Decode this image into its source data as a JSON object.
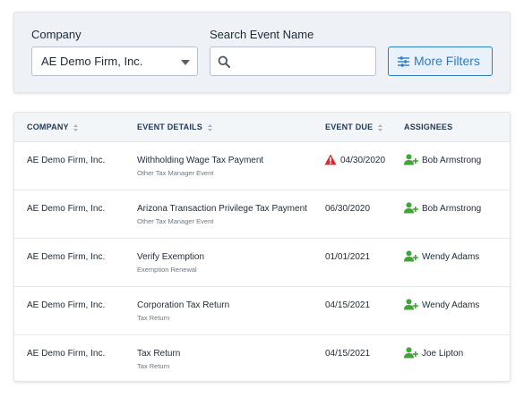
{
  "filters": {
    "company_label": "Company",
    "company_value": "AE Demo Firm, Inc.",
    "search_label": "Search Event Name",
    "search_value": "",
    "search_placeholder": "",
    "more_filters_label": "More Filters"
  },
  "table": {
    "headers": {
      "company": "COMPANY",
      "event_details": "EVENT DETAILS",
      "event_due": "EVENT DUE",
      "assignees": "ASSIGNEES"
    },
    "rows": [
      {
        "company": "AE Demo Firm, Inc.",
        "event": "Withholding Wage Tax Payment",
        "event_type": "Other Tax Manager Event",
        "due": "04/30/2020",
        "overdue": true,
        "assignee": "Bob Armstrong"
      },
      {
        "company": "AE Demo Firm, Inc.",
        "event": "Arizona Transaction Privilege Tax Payment",
        "event_type": "Other Tax Manager Event",
        "due": "06/30/2020",
        "overdue": false,
        "assignee": "Bob Armstrong"
      },
      {
        "company": "AE Demo Firm, Inc.",
        "event": "Verify Exemption",
        "event_type": "Exemption Renewal",
        "due": "01/01/2021",
        "overdue": false,
        "assignee": "Wendy Adams"
      },
      {
        "company": "AE Demo Firm, Inc.",
        "event": "Corporation Tax Return",
        "event_type": "Tax Return",
        "due": "04/15/2021",
        "overdue": false,
        "assignee": "Wendy Adams"
      },
      {
        "company": "AE Demo Firm, Inc.",
        "event": "Tax Return",
        "event_type": "Tax Return",
        "due": "04/15/2021",
        "overdue": false,
        "assignee": "Joe Lipton"
      }
    ]
  },
  "colors": {
    "accent": "#2f7bbf",
    "warning": "#d32f2f",
    "assignee_icon": "#3fa535"
  },
  "icons": {
    "search": "search-icon",
    "filter": "sliders-icon",
    "sort": "sort-icon",
    "warning": "warning-icon",
    "assignee": "person-add-icon"
  }
}
